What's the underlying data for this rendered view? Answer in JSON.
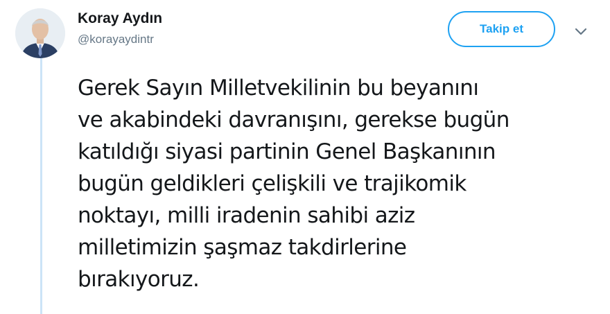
{
  "author": {
    "display_name": "Koray Aydın",
    "handle": "@korayaydintr",
    "avatar_icon": "person-avatar"
  },
  "actions": {
    "follow_label": "Takip et",
    "menu_icon": "chevron-down-icon"
  },
  "tweet": {
    "lines": [
      "Gerek Sayın Milletvekilinin bu beyanını",
      "ve akabindeki davranışını, gerekse bugün",
      "katıldığı siyasi partinin Genel Başkanının",
      "bugün geldikleri çelişkili ve trajikomik",
      "noktayı, milli iradenin sahibi aziz",
      "milletimizin şaşmaz takdirlerine",
      "bırakıyoruz."
    ]
  },
  "colors": {
    "accent": "#1da1f2",
    "text": "#14171a",
    "secondary_text": "#657786",
    "thread_line": "#cce4f7"
  }
}
